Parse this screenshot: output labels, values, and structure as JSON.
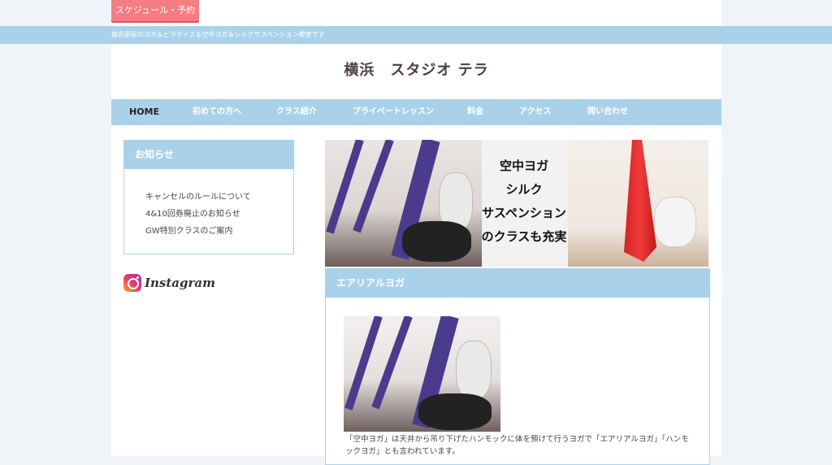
{
  "header": {
    "schedule_button": "スケジュール・予約",
    "description": "菊名駅前のヨガ＆ピラティス＆空中ヨガ＆シルクサスペンション教室です",
    "site_title": "横浜　スタジオ テラ"
  },
  "nav": {
    "items": [
      {
        "label": "HOME"
      },
      {
        "label": "初めての方へ"
      },
      {
        "label": "クラス紹介"
      },
      {
        "label": "プライベートレッスン"
      },
      {
        "label": "料金"
      },
      {
        "label": "アクセス"
      },
      {
        "label": "問い合わせ"
      }
    ]
  },
  "sidebar": {
    "news_title": "お知らせ",
    "news_items": [
      "キャンセルのルールについて",
      "4&10回券廃止のお知らせ",
      "GW特別クラスのご案内"
    ],
    "instagram_label": "Instagram"
  },
  "banner": {
    "lines": [
      "空中ヨガ",
      "シルク",
      "サスペンション",
      "のクラスも充実"
    ]
  },
  "section": {
    "title": "エアリアルヨガ",
    "body": "「空中ヨガ」は天井から吊り下げたハンモックに体を預けて行うヨガで「エアリアルヨガ」「ハンモックヨガ」とも言われています。"
  },
  "colors": {
    "accent": "#a9d2ea",
    "button": "#f47c82"
  }
}
